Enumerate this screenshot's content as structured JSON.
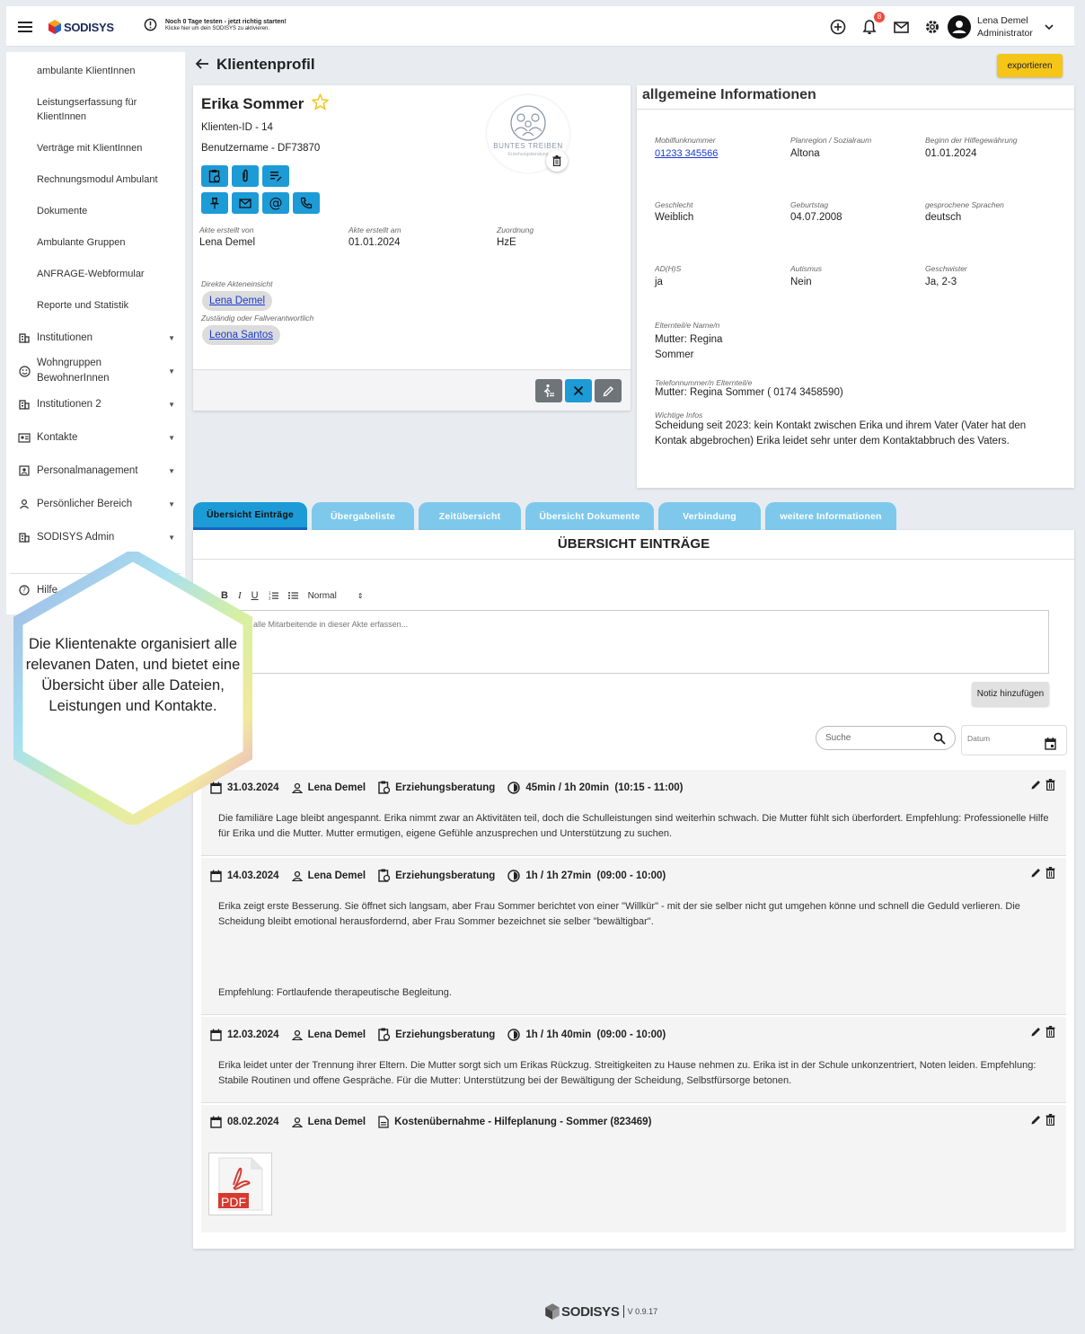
{
  "topbar": {
    "logo": "SODISYS",
    "trial_title": "Noch 0 Tage testen - jetzt richtig starten!",
    "trial_sub": "Klicke hier um dein SODISYS zu aktivieren.",
    "notifications_count": "8",
    "user_name": "Lena Demel",
    "user_role": "Administrator"
  },
  "sidebar": {
    "sub_items": [
      "ambulante KlientInnen",
      "Leistungserfassung für KlientInnen",
      "Verträge mit KlientInnen",
      "Rechnungsmodul Ambulant",
      "Dokumente",
      "Ambulante Gruppen",
      "ANFRAGE-Webformular",
      "Reporte und Statistik"
    ],
    "main_items": [
      {
        "label": "Institutionen",
        "icon": "building-icon"
      },
      {
        "label": "Wohngruppen BewohnerInnen",
        "icon": "smiley-icon"
      },
      {
        "label": "Institutionen 2",
        "icon": "building-icon"
      },
      {
        "label": "Kontakte",
        "icon": "contact-card-icon"
      },
      {
        "label": "Personalmanagement",
        "icon": "badge-icon"
      },
      {
        "label": "Persönlicher Bereich",
        "icon": "person-icon"
      },
      {
        "label": "SODISYS Admin",
        "icon": "building-icon"
      }
    ],
    "help": "Hilfe"
  },
  "header": {
    "title": "Klientenprofil",
    "export_label": "exportieren"
  },
  "profile": {
    "name": "Erika Sommer",
    "client_id": "Klienten-ID - 14",
    "username": "Benutzername - DF73870",
    "logo_text": "BUNTES TREIBEN",
    "logo_sub": "Erziehungsberatung",
    "created_by_label": "Akte erstellt von",
    "created_by": "Lena Demel",
    "created_at_label": "Akte erstellt am",
    "created_at": "01.01.2024",
    "assignment_label": "Zuordnung",
    "assignment": "HzE",
    "direct_access_label": "Direkte Akteneinsicht",
    "direct_access": "Lena Demel",
    "responsible_label": "Zuständig oder Fallverantwortlich",
    "responsible": "Leona Santos"
  },
  "info": {
    "title": "allgemeine Informationen",
    "fields": {
      "mobile_label": "Mobilfunknummer",
      "mobile": "01233 345566",
      "region_label": "Planregion / Sozialraum",
      "region": "Altona",
      "start_label": "Beginn der Hilfegewährung",
      "start": "01.01.2024",
      "gender_label": "Geschlecht",
      "gender": "Weiblich",
      "birthday_label": "Geburtstag",
      "birthday": "04.07.2008",
      "languages_label": "gesprochene Sprachen",
      "languages": "deutsch",
      "adhs_label": "AD(H)S",
      "adhs": "ja",
      "autism_label": "Autismus",
      "autism": "Nein",
      "siblings_label": "Geschwister",
      "siblings": "Ja, 2-3",
      "parents_label": "Elternteil/e Name/n",
      "parents": "Mutter: Regina Sommer",
      "phone_parents_label": "Telefonnummer/n Elternteil/e",
      "phone_parents": "Mutter: Regina Sommer ( 0174 3458590)",
      "important_label": "Wichtige Infos",
      "important": "Scheidung seit 2023: kein Kontakt zwischen Erika und ihrem Vater (Vater hat den Kontak abgebrochen) Erika leidet sehr unter dem Kontaktabbruch des Vaters."
    }
  },
  "tabs": [
    "Übersicht Einträge",
    "Übergabeliste",
    "Zeitübersicht",
    "Übersicht Dokumente",
    "Verbindung",
    "weitere Informationen"
  ],
  "overview": {
    "title": "ÜBERSICHT EINTRÄGE",
    "format_select": "Normal",
    "note_placeholder": "Notiz für alle Mitarbeitende in dieser Akte erfassen...",
    "add_note": "Notiz hinzufügen",
    "search_placeholder": "Suche",
    "date_placeholder": "Datum"
  },
  "entries": [
    {
      "date": "31.03.2024",
      "user": "Lena Demel",
      "category": "Erziehungsberatung",
      "duration": "45min / 1h 20min  (10:15 - 11:00)",
      "text": "Die familiäre Lage bleibt angespannt. Erika nimmt zwar an Aktivitäten teil, doch die Schulleistungen sind weiterhin schwach. Die Mutter fühlt sich überfordert. Empfehlung: Professionelle Hilfe für Erika und die Mutter. Mutter ermutigen, eigene Gefühle anzusprechen und Unterstützung zu suchen."
    },
    {
      "date": "14.03.2024",
      "user": "Lena Demel",
      "category": "Erziehungsberatung",
      "duration": "1h / 1h 27min  (09:00 - 10:00)",
      "text": "Erika zeigt erste Besserung. Sie öffnet sich langsam, aber Frau Sommer berichtet von einer \"Willkür\" - mit der sie selber nicht gut umgehen könne und schnell die Geduld verlieren. Die Scheidung bleibt emotional herausfordernd, aber Frau Sommer bezeichnet sie selber \"bewältigbar\".",
      "text2": "Empfehlung: Fortlaufende therapeutische Begleitung."
    },
    {
      "date": "12.03.2024",
      "user": "Lena Demel",
      "category": "Erziehungsberatung",
      "duration": "1h / 1h 40min  (09:00 - 10:00)",
      "text": "Erika leidet unter der Trennung ihrer Eltern. Die Mutter sorgt sich um Erikas Rückzug. Streitigkeiten zu Hause nehmen zu. Erika ist in der Schule unkonzentriert, Noten leiden. Empfehlung: Stabile Routinen und offene Gespräche. Für die Mutter: Unterstützung bei der Bewältigung der Scheidung, Selbstfürsorge betonen."
    },
    {
      "date": "08.02.2024",
      "user": "Lena Demel",
      "document": "Kostenübernahme - Hilfeplanung - Sommer (823469)",
      "file_type": "PDF"
    }
  ],
  "overlay": {
    "text": "Die Klientenakte organisiert alle relevanen Daten, und bietet eine Übersicht über alle Dateien, Leistungen und Kontakte."
  },
  "footer": {
    "brand": "SODISYS",
    "version": "V 0.9.17"
  },
  "colors": {
    "accent_blue": "#1d9bd7",
    "export_yellow": "#f5c518",
    "link_blue": "#1a3ad0",
    "star_yellow": "#f5c518"
  }
}
